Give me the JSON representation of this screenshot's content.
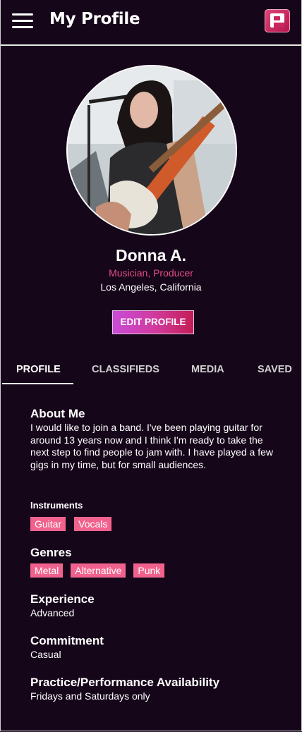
{
  "header": {
    "title": "My Profile",
    "logo_icon": "p-logo-icon"
  },
  "profile": {
    "name": "Donna A.",
    "role": "Musician, Producer",
    "location": "Los Angeles, California",
    "edit_label": "EDIT PROFILE"
  },
  "tabs": [
    {
      "label": "PROFILE",
      "active": true
    },
    {
      "label": "CLASSIFIEDS",
      "active": false
    },
    {
      "label": "MEDIA",
      "active": false
    },
    {
      "label": "SAVED",
      "active": false
    }
  ],
  "about": {
    "title": "About Me",
    "text": "I would like to join a band. I've been playing guitar for around 13 years now and I think I'm ready to take the next step to find people to jam with. I have played a few gigs in my time, but for small audiences."
  },
  "instruments": {
    "title": "Instruments",
    "tags": [
      "Guitar",
      "Vocals"
    ]
  },
  "genres": {
    "title": "Genres",
    "tags": [
      "Metal",
      "Alternative",
      "Punk"
    ]
  },
  "experience": {
    "title": "Experience",
    "value": "Advanced"
  },
  "commitment": {
    "title": "Commitment",
    "value": "Casual"
  },
  "availability": {
    "title": "Practice/Performance Availability",
    "value": "Fridays and Saturdays only"
  },
  "colors": {
    "background": "#16061a",
    "accent": "#e34d84",
    "tag": "#f0628d"
  }
}
